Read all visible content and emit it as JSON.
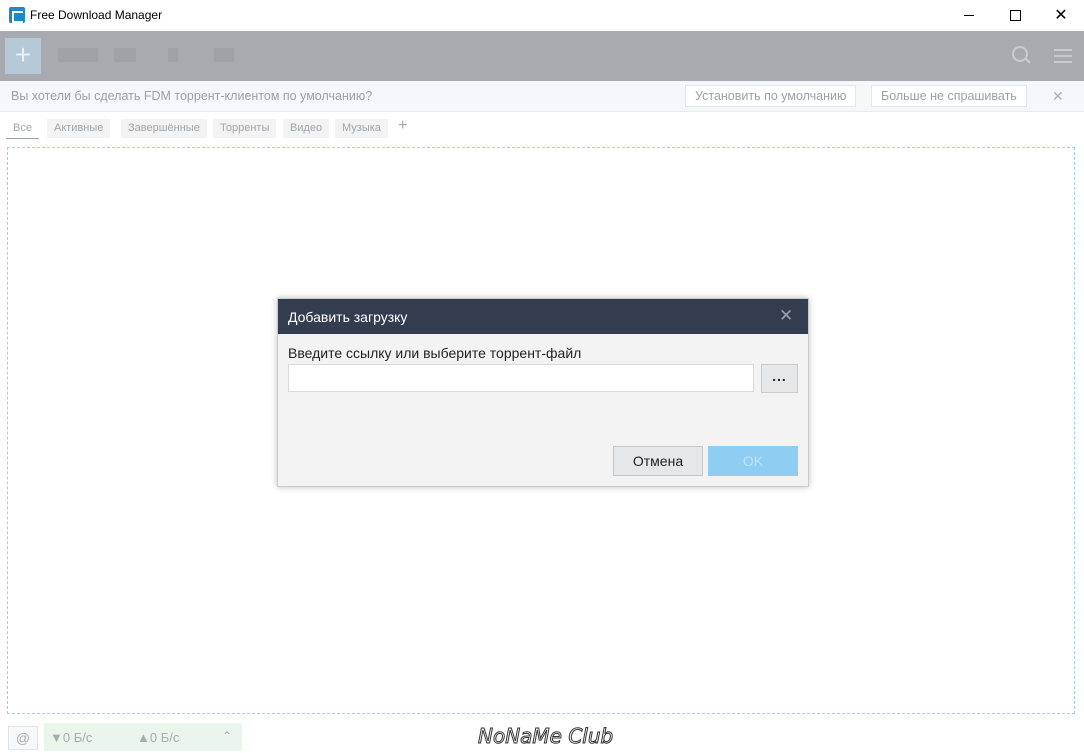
{
  "window": {
    "title": "Free Download Manager"
  },
  "notice": {
    "text": "Вы хотели бы сделать FDM торрент-клиентом по умолчанию?",
    "set_default_label": "Установить по умолчанию",
    "never_ask_label": "Больше не спрашивать",
    "close_glyph": "✕"
  },
  "tabs": [
    {
      "label": "Все",
      "active": true
    },
    {
      "label": "Активные",
      "active": false
    },
    {
      "label": "Завершённые",
      "active": false
    },
    {
      "label": "Торренты",
      "active": false
    },
    {
      "label": "Видео",
      "active": false
    },
    {
      "label": "Музыка",
      "active": false
    }
  ],
  "tabs_add_glyph": "+",
  "toolbar": {
    "add_glyph": "+"
  },
  "statusbar": {
    "download_speed": "▼0 Б/с",
    "upload_speed": "▲0 Б/с",
    "snail_glyph": "@",
    "chevron_glyph": "⌃"
  },
  "watermark": "NoNaMe Club",
  "dialog": {
    "title": "Добавить загрузку",
    "close_glyph": "✕",
    "prompt": "Введите ссылку или выберите торрент-файл",
    "url_value": "",
    "browse_label": "...",
    "cancel_label": "Отмена",
    "ok_label": "OK"
  },
  "colors": {
    "dialog_header": "#343c4f",
    "ok_button": "#8fcdf3",
    "toolbar_dimmed": "#a7abb0",
    "dropzone_border": "#9fd0e6"
  }
}
